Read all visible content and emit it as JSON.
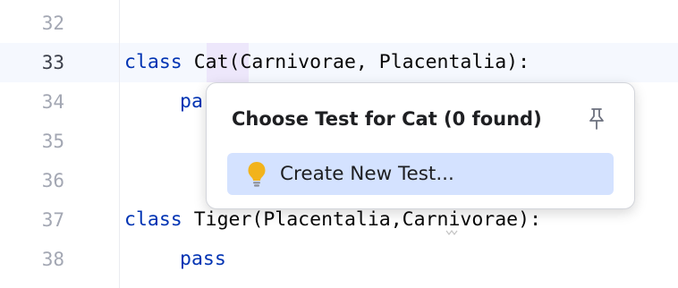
{
  "editor": {
    "line_numbers": [
      "32",
      "33",
      "34",
      "35",
      "36",
      "37",
      "38"
    ],
    "lines": {
      "l33_kw": "class",
      "l33_rest": "Cat(Carnivorae, Placentalia):",
      "l34_text": "pa",
      "l37_kw": "class",
      "l37_rest": "Tiger(Placentalia,Carnivorae):",
      "l38_kw": "pass"
    }
  },
  "popup": {
    "title": "Choose Test for Cat (0 found)",
    "pin_icon": "pin-icon",
    "items": [
      {
        "label": "Create New Test...",
        "icon": "lightbulb-icon"
      }
    ]
  },
  "colors": {
    "keyword": "#0033b3",
    "selected_item_bg": "#d4e2ff",
    "current_line_bg": "#f5f8fe",
    "bulb": "#f2b31b"
  }
}
